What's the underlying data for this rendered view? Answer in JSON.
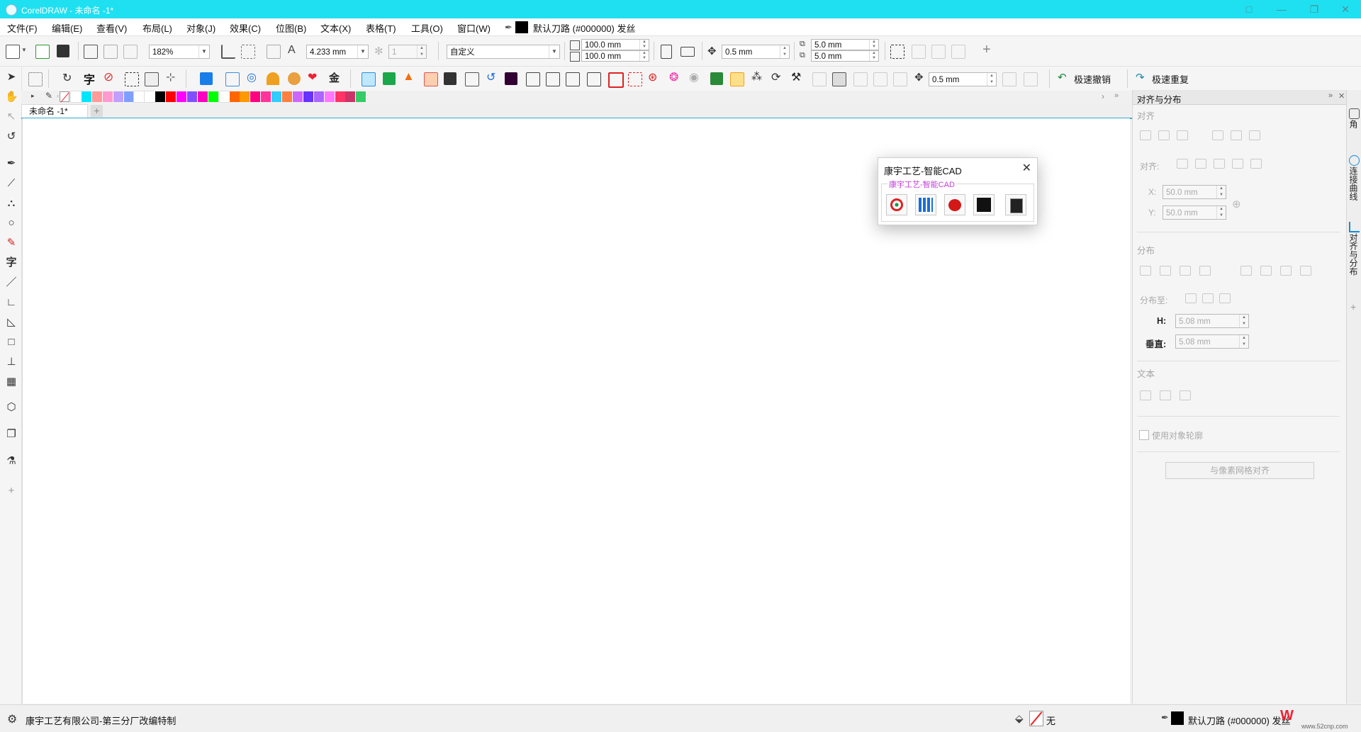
{
  "window": {
    "title": "CorelDRAW - 未命名 -1*",
    "buttons": [
      "□",
      "—",
      "❐",
      "✕"
    ]
  },
  "menu": [
    "文件(F)",
    "编辑(E)",
    "查看(V)",
    "布局(L)",
    "对象(J)",
    "效果(C)",
    "位图(B)",
    "文本(X)",
    "表格(T)",
    "工具(O)",
    "窗口(W)"
  ],
  "menu_outline": "默认刀路 (#000000) 发丝",
  "toolbar1": {
    "zoom": "182%",
    "font_size": "4.233 mm",
    "pages": "1",
    "page_size": "自定义",
    "width": "100.0 mm",
    "height": "100.0 mm",
    "nudge": "0.5 mm",
    "dup_x": "5.0 mm",
    "dup_y": "5.0 mm",
    "add": "+"
  },
  "toolbar2": {
    "outline_width": "0.5 mm",
    "undo_label": "极速撤销",
    "redo_label": "极速重复",
    "text_tool": "字",
    "gold": "金"
  },
  "palette": {
    "colors": [
      "#ffffff",
      "#00e6ff",
      "#ff9a9a",
      "#ff9ad0",
      "#c0a0ff",
      "#7f9fff",
      "#ffffff",
      "#ffffff",
      "#000000",
      "#ff0000",
      "#ff00ff",
      "#8050ff",
      "#ff00c0",
      "#00ff00",
      "#ffffff",
      "#ff6600",
      "#ff9900",
      "#ff0080",
      "#ff3399",
      "#33ccff",
      "#ff8040",
      "#cc66ff",
      "#6633ff",
      "#aa66ff",
      "#ff77ff",
      "#ff3366",
      "#cc3366",
      "#33cc66"
    ]
  },
  "doc_tab": {
    "label": "未命名 -1*",
    "add": "+"
  },
  "docker": {
    "title": "对齐与分布",
    "align_section": "对齐",
    "align_to_label": "对齐:",
    "x_label": "X:",
    "x_value": "50.0 mm",
    "y_label": "Y:",
    "y_value": "50.0 mm",
    "distribute_section": "分布",
    "distribute_to_label": "分布至:",
    "h_label": "H:",
    "h_value": "5.08 mm",
    "v_label": "垂直:",
    "v_value": "5.08 mm",
    "text_section": "文本",
    "use_outline": "使用对象轮廓",
    "pixel_grid_button": "与像素网格对齐"
  },
  "right_tabs": [
    "角",
    "连接曲线",
    "对齐与分布"
  ],
  "plugin": {
    "title": "康宇工艺-智能CAD",
    "group_label": "康宇工艺-智能CAD"
  },
  "statusbar": {
    "company": "康宇工艺有限公司-第三分厂改编特制",
    "fill": "无",
    "outline": "默认刀路 (#000000) 发丝"
  },
  "watermark": "www.52cnp.com"
}
